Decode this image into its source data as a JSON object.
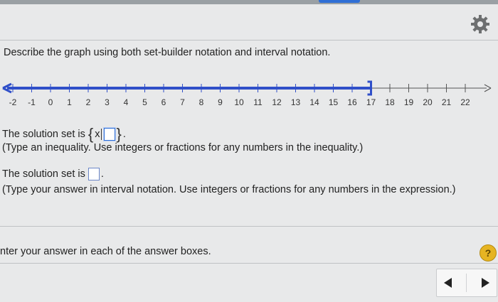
{
  "question": {
    "prompt": "Describe the graph using both set-builder notation and interval notation."
  },
  "number_line": {
    "ticks": [
      "-2",
      "-1",
      "0",
      "1",
      "2",
      "3",
      "4",
      "5",
      "6",
      "7",
      "8",
      "9",
      "10",
      "11",
      "12",
      "13",
      "14",
      "15",
      "16",
      "17",
      "18",
      "19",
      "20",
      "21",
      "22"
    ],
    "shaded_to": "17",
    "endpoint": "closed bracket",
    "shade_color": "#2f4fc9"
  },
  "answer1": {
    "lead": "The solution set is",
    "set_open": "{",
    "set_var": "x",
    "set_close": "}",
    "dot": ".",
    "hint": "(Type an inequality. Use integers or fractions for any numbers in the inequality.)"
  },
  "answer2": {
    "lead": "The solution set is",
    "dot": ".",
    "hint": "(Type your answer in interval notation. Use integers or fractions for any numbers in the expression.)"
  },
  "footer": {
    "instruction": "nter your answer in each of the answer boxes."
  },
  "help": {
    "label": "?"
  },
  "icons": {
    "settings": "gear-icon",
    "help": "question-mark-icon",
    "prev": "arrow-left-icon",
    "next": "arrow-right-icon"
  },
  "colors": {
    "accent": "#2f6fd6",
    "help_button": "#e6b422"
  }
}
